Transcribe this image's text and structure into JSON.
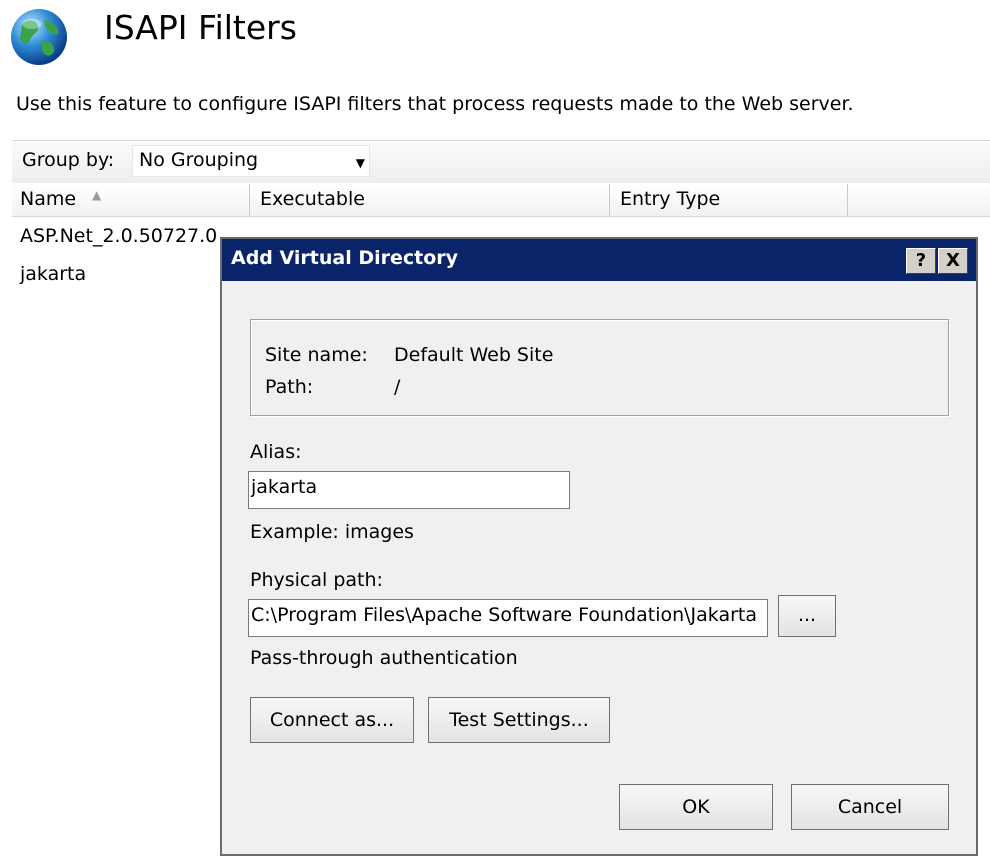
{
  "page": {
    "title": "ISAPI Filters",
    "description": "Use this feature to configure ISAPI filters that process requests made to the Web server."
  },
  "group_by": {
    "label": "Group by:",
    "value": "No Grouping"
  },
  "list": {
    "columns": [
      "Name",
      "Executable",
      "Entry Type"
    ],
    "rows": [
      {
        "name": "ASP.Net_2.0.50727.0"
      },
      {
        "name": "jakarta"
      }
    ]
  },
  "dialog": {
    "title": "Add Virtual Directory",
    "help_label": "?",
    "close_label": "X",
    "site_name_label": "Site name:",
    "site_name_value": "Default Web Site",
    "path_label": "Path:",
    "path_value": "/",
    "alias_label": "Alias:",
    "alias_value": "jakarta",
    "alias_example": "Example: images",
    "physical_path_label": "Physical path:",
    "physical_path_value": "C:\\Program Files\\Apache Software Foundation\\Jakarta",
    "browse_label": "...",
    "auth_label": "Pass-through authentication",
    "connect_as_label": "Connect as...",
    "test_settings_label": "Test Settings...",
    "ok_label": "OK",
    "cancel_label": "Cancel"
  },
  "colors": {
    "titlebar": "#0a246a",
    "dialog_bg": "#f0f0f0"
  }
}
